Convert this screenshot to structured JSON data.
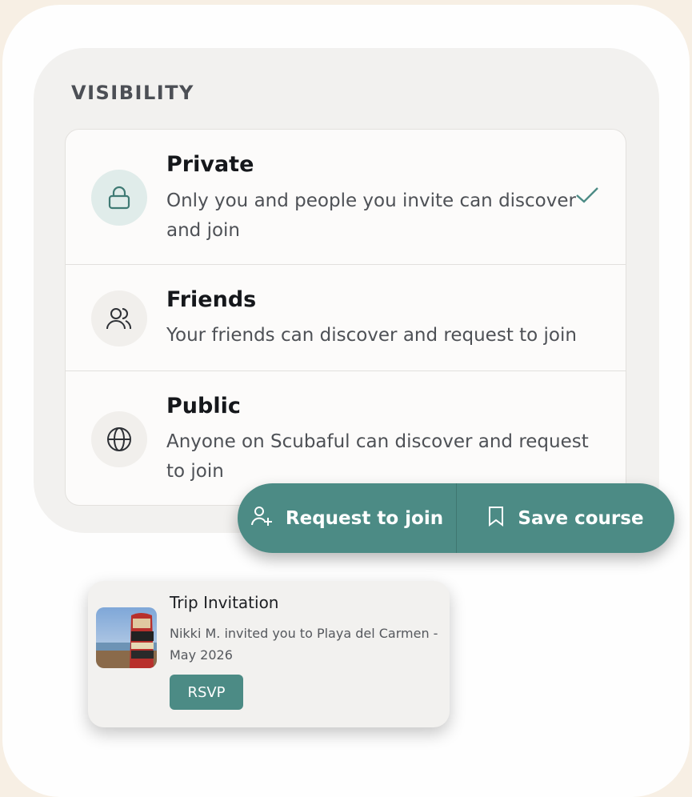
{
  "visibility": {
    "title": "VISIBILITY",
    "options": [
      {
        "label": "Private",
        "description": "Only you and people you invite can discover and join",
        "icon": "lock-icon",
        "selected": true
      },
      {
        "label": "Friends",
        "description": "Your friends can discover and request to join",
        "icon": "friends-icon",
        "selected": false
      },
      {
        "label": "Public",
        "description": "Anyone on Scubaful can discover and request to join",
        "icon": "globe-icon",
        "selected": false
      }
    ]
  },
  "actions": {
    "request_label": "Request to join",
    "save_label": "Save course"
  },
  "notification": {
    "title": "Trip Invitation",
    "body": "Nikki M. invited you to Playa del Carmen - May 2026",
    "button_label": "RSVP"
  },
  "colors": {
    "accent": "#4c8b85",
    "background": "#f7efe4"
  }
}
